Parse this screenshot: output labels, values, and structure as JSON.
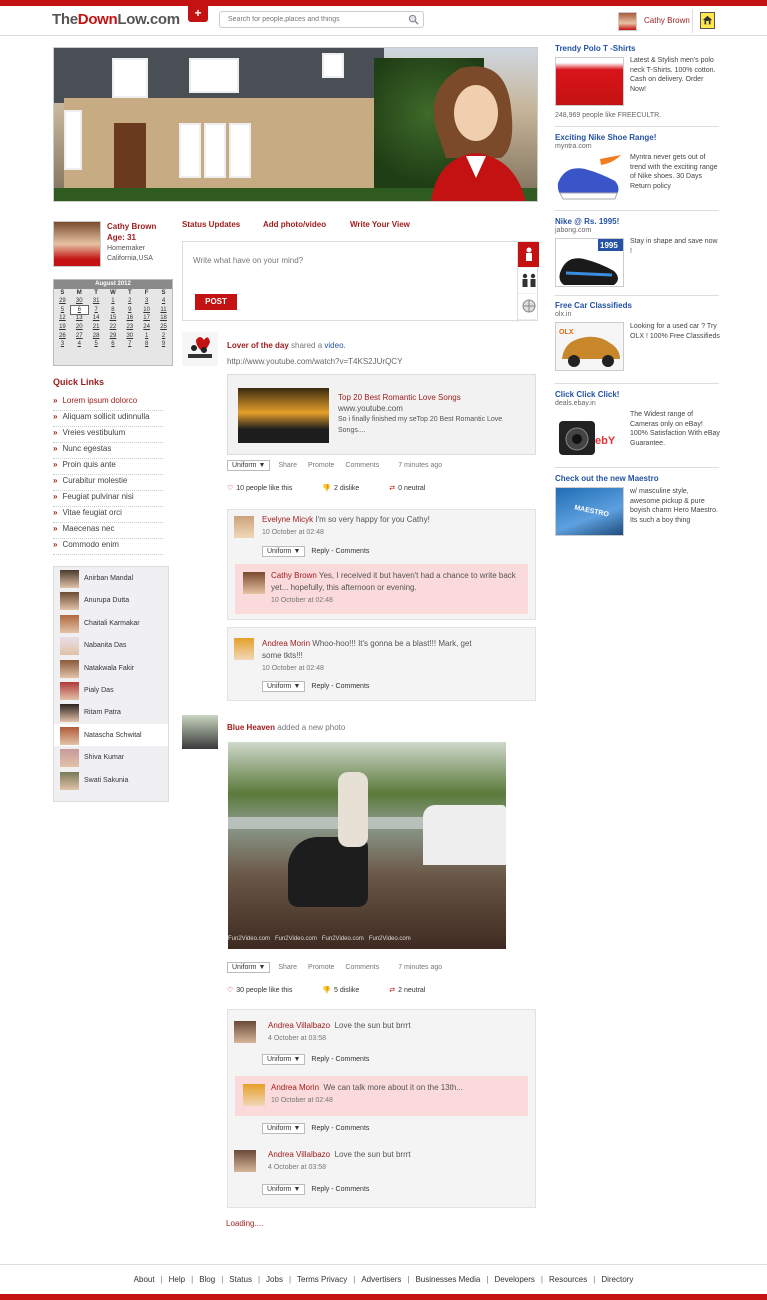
{
  "header": {
    "logo": {
      "part1": "The",
      "part2": "Down",
      "part3": "Low.com"
    },
    "plus": "+",
    "search_placeholder": "Search for people,places and things",
    "user_name": "Cathy Brown"
  },
  "profile": {
    "name": "Cathy Brown",
    "age": "Age: 31",
    "role": "Homemaker",
    "location": "California,USA"
  },
  "calendar": {
    "title": "August 2012",
    "days": [
      "S",
      "M",
      "T",
      "W",
      "T",
      "F",
      "S"
    ],
    "weeks": [
      [
        "29",
        "30",
        "31",
        "1",
        "2",
        "3",
        "4"
      ],
      [
        "5",
        "6",
        "7",
        "8",
        "9",
        "10",
        "11"
      ],
      [
        "12",
        "13",
        "14",
        "15",
        "16",
        "17",
        "18"
      ],
      [
        "19",
        "20",
        "21",
        "22",
        "23",
        "24",
        "25"
      ],
      [
        "26",
        "27",
        "28",
        "29",
        "30",
        "1",
        "2"
      ],
      [
        "3",
        "4",
        "5",
        "6",
        "7",
        "8",
        "9"
      ]
    ],
    "today": "6"
  },
  "quick_links": {
    "title": "Quick Links",
    "items": [
      "Lorem ipsum dolorco",
      "Aliquam sollicit udinnulla",
      "Vreies vestibulum",
      "Nunc egestas",
      "Proin quis ante",
      "Curabitur molestie",
      "Feugiat pulvinar nisi",
      "Vitae feugiat orci",
      "Maecenas nec",
      "Commodo enim"
    ]
  },
  "friends": [
    "Anirban Mandal",
    "Anurupa Dutta",
    "Chaitali Karmakar",
    "Nabanita Das",
    "Natakwala Fakir",
    "Pialy Das",
    "Ritam Patra",
    "Natascha Schwital",
    "Shiva Kumar",
    "Swati Sakunia"
  ],
  "status": {
    "tabs": [
      "Status Updates",
      "Add photo/video",
      "Write Your View"
    ],
    "placeholder": "Write what have on your mind?",
    "post": "POST"
  },
  "feed": {
    "post1": {
      "author": "Lover of the day",
      "action": "shared a",
      "object": "video.",
      "url": "http://www.youtube.com/watch?v=T4KS2JUrQCY",
      "card_title": "Top 20 Best Romantic Love Songs",
      "card_site": "www.youtube.com",
      "card_desc": "So i finally finished my seTop 20 Best Romantic Love Songs....",
      "select": "Uniform",
      "share": "Share",
      "promote": "Promote",
      "comments": "Comments",
      "time": "7 minutes ago",
      "likes": "10 people like this",
      "dislikes": "2 dislike",
      "neutral": "0 neutral",
      "c1_name": "Evelyne Micyk",
      "c1_text": "I'm so very happy for you Cathy!",
      "c1_time": "10 October at 02:48",
      "r1_name": "Cathy Brown",
      "r1_text": "Yes, I received it but haven't had a chance to write back yet... hopefully, this afternoon or evening.",
      "r1_time": "10 October at 02:48",
      "c2_name": "Andrea Morin",
      "c2_text": "Whoo-hoo!!! It's gonna be a blast!!! Mark, get some tkts!!!",
      "c2_time": "10 October at 02:48",
      "reply": "Reply",
      "dash": "-",
      "comments_lnk": "Comments"
    },
    "post2": {
      "author": "Blue Heaven",
      "action": "added a new photo",
      "select": "Uniform",
      "share": "Share",
      "promote": "Promote",
      "comments": "Comments",
      "time": "7 minutes ago",
      "likes": "30 people like this",
      "dislikes": "5 dislike",
      "neutral": "2 neutral",
      "watermark": "Fun2Video.com",
      "c1_name": "Andrea Villalbazo",
      "c1_text": "Love the sun but brrrt",
      "c1_time": "4 October at 03:58",
      "r1_name": "Andrea Morin",
      "r1_text": "We can talk more about it on the 13th...",
      "r1_time": "10 October at 02:48",
      "c2_name": "Andrea Villalbazo",
      "c2_text": "Love the sun but brrrt",
      "c2_time": "4 October at 03:58"
    },
    "loading": "Loading...."
  },
  "ads": [
    {
      "title": "Trendy Polo T -Shirts",
      "sub": "",
      "text": "Latest & Stylish men's polo neck T-Shirts. 100% cotton. Cash on delivery. Order Now!",
      "extra": "248,969 people like FREECULTR."
    },
    {
      "title": "Exciting Nike Shoe Range!",
      "sub": "myntra.com",
      "text": "Myntra never gets out of trend with the exciting range of Nike shoes. 30 Days Return policy"
    },
    {
      "title": "Nike @ Rs. 1995!",
      "sub": "jabong.com",
      "text": "Stay in shape and save now !",
      "badge": "1995"
    },
    {
      "title": "Free Car Classifieds",
      "sub": "olx.in",
      "text": "Looking for a used car ? Try OLX ! 100% Free Classifieds",
      "badge": "OLX"
    },
    {
      "title": "Click Click Click!",
      "sub": "deals.ebay.in",
      "text": "The Widest range of Cameras only on eBay! 100% Satisfaction With eBay Guarantee.",
      "badge": "ebY"
    },
    {
      "title": "Check out the new Maestro",
      "sub": "",
      "text": "w/ masculine style, awesome pickup & pure boyish charm Hero Maestro. Its such a boy thing",
      "badge": "MAESTRO"
    }
  ],
  "footer": [
    "About",
    "Help",
    "Blog",
    "Status",
    "Jobs",
    "Terms Privacy",
    "Advertisers",
    "Businesses Media",
    "Developers",
    "Resources",
    "Directory"
  ],
  "colors": {
    "brand": "#c41212",
    "link_blue": "#2552a4",
    "name_red": "#9e1b1b",
    "reply_pink": "#fadadb"
  }
}
